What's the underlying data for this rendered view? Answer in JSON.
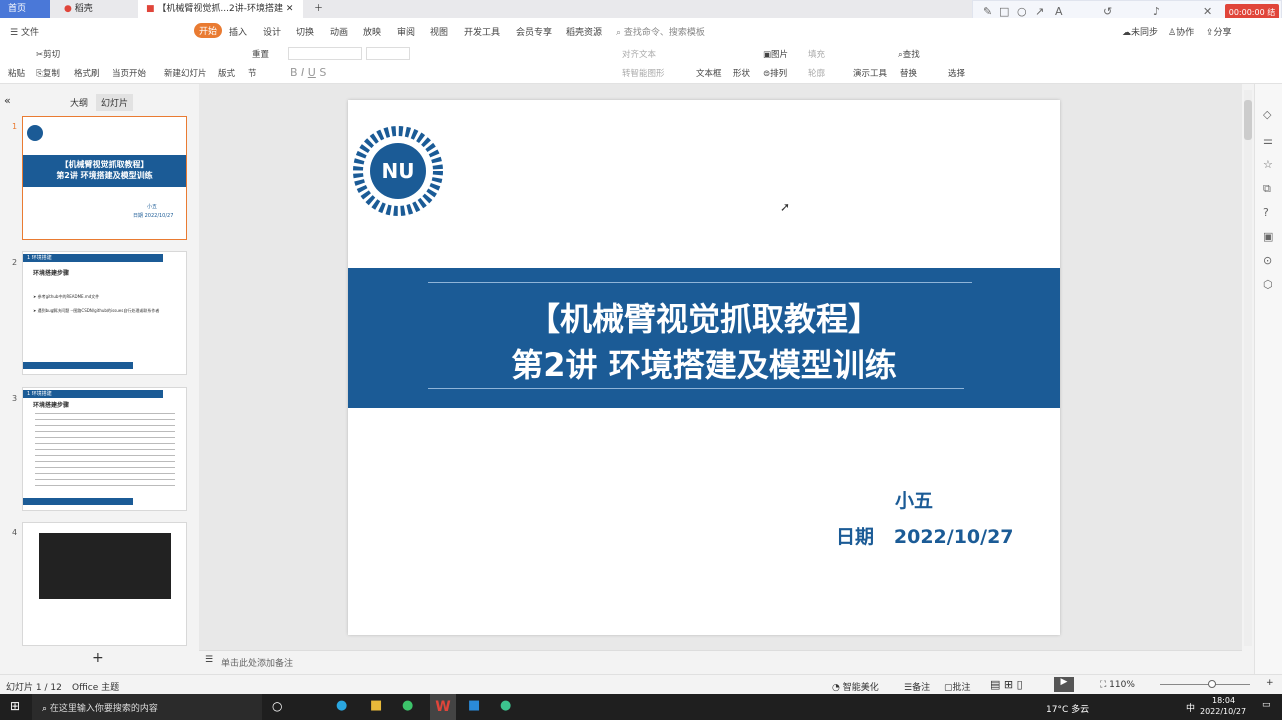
{
  "tabs": [
    "首页",
    "稻壳",
    "【机械臂视觉抓...2讲-环境搭建"
  ],
  "menu": {
    "file": "文件",
    "items": [
      "开始",
      "插入",
      "设计",
      "切换",
      "动画",
      "放映",
      "审阅",
      "视图",
      "开发工具",
      "会员专享",
      "稻壳资源"
    ],
    "search": "查找命令、搜索模板",
    "sync": "未同步",
    "collab": "协作",
    "share": "分享"
  },
  "ribbon": {
    "cut": "剪切",
    "paste": "粘贴",
    "copy": "复制",
    "format_painter": "格式刷",
    "play_from_current": "当页开始",
    "new_slide": "新建幻灯片",
    "layout": "版式",
    "section": "节",
    "reset": "重置",
    "textbox": "文本框",
    "shape": "形状",
    "image": "图片",
    "arrange": "排列",
    "fill": "填充",
    "outline": "轮廓",
    "presenter_tools": "演示工具",
    "find": "查找",
    "replace": "替换",
    "select": "选择",
    "align_text": "对齐文本",
    "smart_art": "转智能图形"
  },
  "recorder": {
    "time": "00:00:00 结束"
  },
  "panel": {
    "outline_tab": "大纲",
    "slides_tab": "幻灯片"
  },
  "thumbs": {
    "t1": {
      "title1": "【机械臂视觉抓取教程】",
      "title2": "第2讲 环境搭建及模型训练",
      "author": "小五",
      "date": "日期 2022/10/27"
    },
    "t2": {
      "header": "1 环境搭建",
      "title": "环境搭建步骤",
      "b1": "参考github中的README.md文件",
      "b2": "遇到bug解决问题 --图路CSDN/github的issues自行处理或联系作者"
    },
    "t3": {
      "header": "1 环境搭建",
      "title": "环境搭建步骤"
    }
  },
  "slide": {
    "title1": "【机械臂视觉抓取教程】",
    "title2": "第2讲 环境搭建及模型训练",
    "author": "小五",
    "date_label": "日期",
    "date": "2022/10/27"
  },
  "notes_placeholder": "单击此处添加备注",
  "status": {
    "slide_count": "幻灯片 1 / 12",
    "theme": "Office 主题",
    "beautify": "智能美化",
    "notes": "备注",
    "comments": "批注",
    "zoom": "110%"
  },
  "taskbar": {
    "search": "在这里输入你要搜索的内容",
    "weather": "17°C 多云",
    "ime": "中",
    "time": "18:04",
    "date": "2022/10/27"
  },
  "colors": {
    "accent": "#1b5b96",
    "wps_red": "#e0453a"
  }
}
